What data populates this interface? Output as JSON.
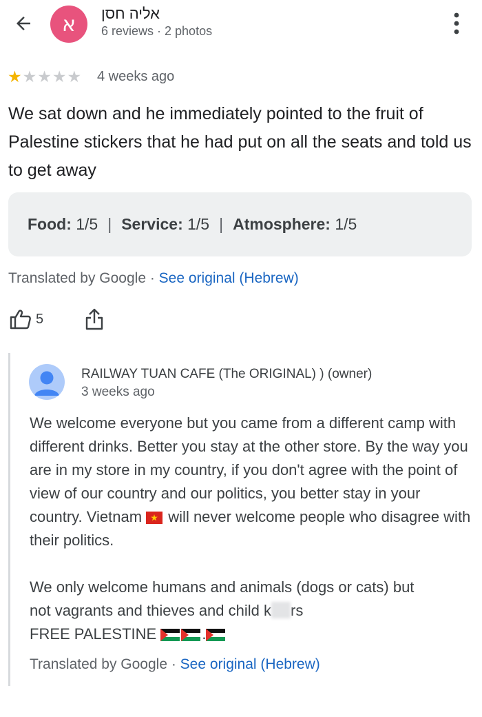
{
  "header": {
    "avatar_letter": "א",
    "author_name": "אליה חסן",
    "author_meta": "6 reviews · 2 photos"
  },
  "review": {
    "rating": 1,
    "rating_max": 5,
    "date": "4 weeks ago",
    "text": "We sat down and he immediately pointed to the fruit of Palestine stickers that he had put on all the seats and told us to get away",
    "ratings": [
      {
        "label": "Food:",
        "value": "1/5"
      },
      {
        "label": "Service:",
        "value": "1/5"
      },
      {
        "label": "Atmosphere:",
        "value": "1/5"
      }
    ],
    "translated_prefix": "Translated by Google · ",
    "see_original": "See original (Hebrew)",
    "like_count": "5"
  },
  "owner_reply": {
    "name": "RAILWAY TUAN CAFE (The ORIGINAL) ) (owner)",
    "date": "3 weeks ago",
    "para1_part1": "We welcome everyone but you came from a different camp with different drinks. Better you stay at the other store. By the way you are in my store in my country, if you don't agree with the point of view of our country and our politics, you better stay in your country. Vietnam",
    "para1_part2": " will never welcome people who disagree with their politics.",
    "para2_line1": "We only welcome humans and animals (dogs or cats) but",
    "para2_line2a": "not vagrants and thieves and child k",
    "para2_line2b": "rs",
    "para2_line3": "FREE PALESTINE",
    "translated_prefix": "Translated by Google · ",
    "see_original": "See original (Hebrew)"
  },
  "colors": {
    "avatar": "#e8537d",
    "star": "#f4b400",
    "link": "#1a66c2",
    "ratings_bg": "#eef0f1"
  },
  "icons": [
    "back-arrow-icon",
    "more-vert-icon",
    "thumb-up-icon",
    "share-icon",
    "person-icon",
    "vietnam-flag-icon",
    "palestine-flag-icon"
  ]
}
